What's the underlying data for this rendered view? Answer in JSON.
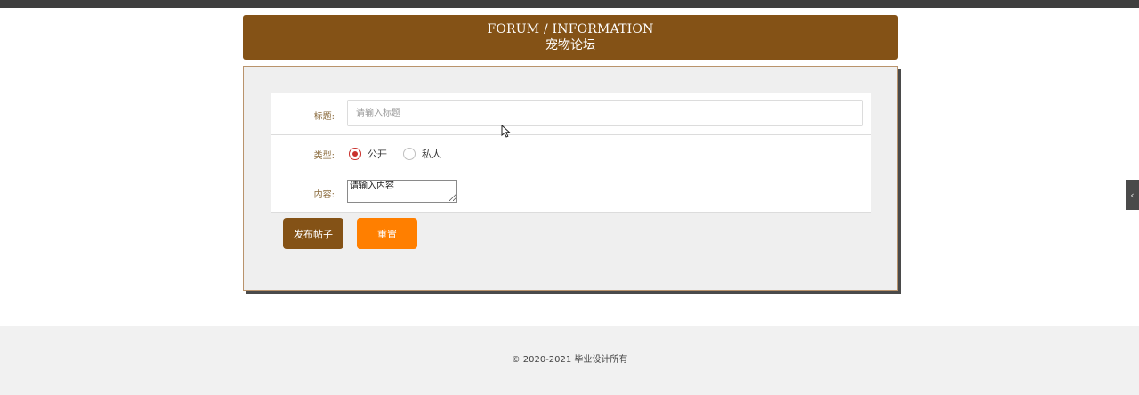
{
  "header": {
    "title_en": "FORUM / INFORMATION",
    "title_cn": "宠物论坛"
  },
  "form": {
    "title": {
      "label": "标题:",
      "placeholder": "请输入标题",
      "value": ""
    },
    "type": {
      "label": "类型:",
      "options": [
        {
          "label": "公开",
          "checked": true
        },
        {
          "label": "私人",
          "checked": false
        }
      ]
    },
    "content": {
      "label": "内容:",
      "placeholder": "请输入内容",
      "value": ""
    }
  },
  "buttons": {
    "submit_label": "发布帖子",
    "reset_label": "重置"
  },
  "side_tab": {
    "icon": "chevron-left-icon",
    "glyph": "‹"
  },
  "footer": {
    "copyright": "© 2020-2021 毕业设计所有"
  },
  "colors": {
    "brand_brown": "#845216",
    "accent_orange": "#ff7f00",
    "radio_checked": "#c9302c"
  }
}
